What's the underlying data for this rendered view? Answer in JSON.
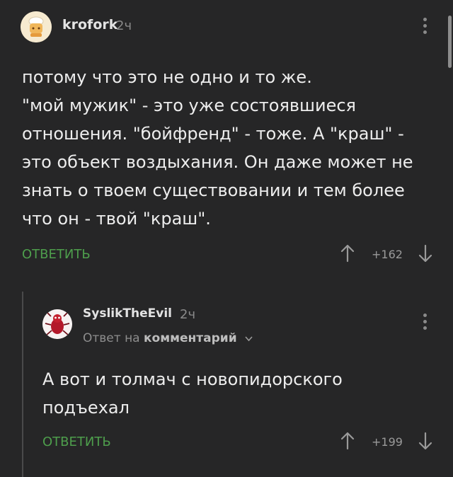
{
  "comments": [
    {
      "author": "krofork",
      "time": "2ч",
      "text": "потому что это не одно и то же.\n\"мой мужик\" - это уже состоявшиеся\nотношения. \"бойфренд\" - тоже. А \"краш\" -\nэто объект воздыхания. Он даже может не\nзнать о твоем существовании и тем более\nчто он - твой \"краш\".",
      "reply_label": "ОТВЕТИТЬ",
      "rating": "+162"
    },
    {
      "author": "SyslikTheEvil",
      "time": "2ч",
      "reply_to_prefix": "Ответ на",
      "reply_to_link": "комментарий",
      "text": "А вот и толмач с новопидорского\nподъехал",
      "reply_label": "ОТВЕТИТЬ",
      "rating": "+199"
    }
  ],
  "icons": {
    "upvote": "arrow-up-icon",
    "downvote": "arrow-down-icon",
    "more": "kebab-menu-icon",
    "chevron": "chevron-down-icon"
  },
  "colors": {
    "background": "#262627",
    "accent_green": "#4e9e4c",
    "muted": "#8a8a8a"
  }
}
